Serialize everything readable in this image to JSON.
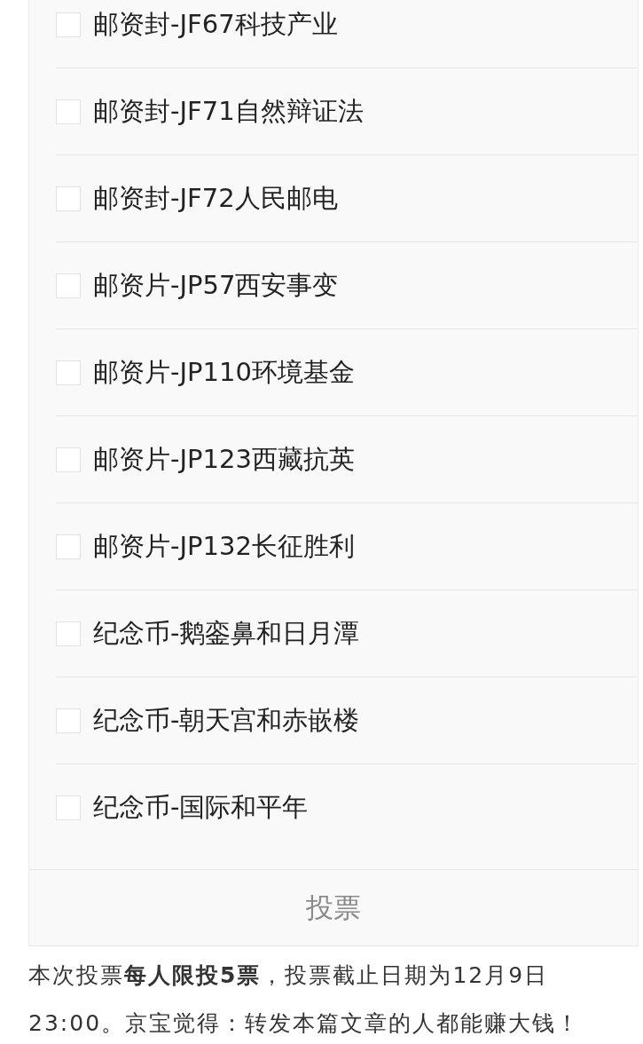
{
  "poll": {
    "options": [
      {
        "label": "邮资封-JF67科技产业",
        "checked": false
      },
      {
        "label": "邮资封-JF71自然辩证法",
        "checked": false
      },
      {
        "label": "邮资封-JF72人民邮电",
        "checked": false
      },
      {
        "label": "邮资片-JP57西安事变",
        "checked": false
      },
      {
        "label": "邮资片-JP110环境基金",
        "checked": false
      },
      {
        "label": "邮资片-JP123西藏抗英",
        "checked": false
      },
      {
        "label": "邮资片-JP132长征胜利",
        "checked": false
      },
      {
        "label": "纪念币-鹅銮鼻和日月潭",
        "checked": false
      },
      {
        "label": "纪念币-朝天宫和赤嵌楼",
        "checked": false
      },
      {
        "label": "纪念币-国际和平年",
        "checked": false
      }
    ],
    "button": "投票"
  },
  "note": "本次投票**每人限投5票**，投票截止日期为12月9日23:00。京宝觉得：转发本篇文章的人都能赚大钱！"
}
